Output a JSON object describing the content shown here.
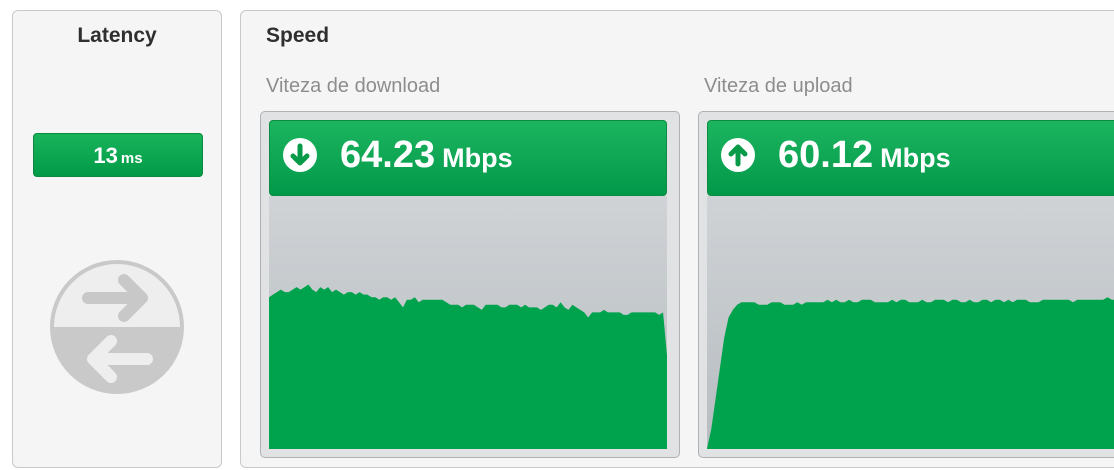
{
  "latency": {
    "title": "Latency",
    "value": "13",
    "unit": "ms",
    "icon": "exchange-arrows-icon"
  },
  "speed": {
    "title": "Speed",
    "download": {
      "label": "Viteza de download",
      "value": "64.23",
      "unit": "Mbps",
      "icon": "download-arrow-icon",
      "chart_fraction_samples": [
        0.6,
        0.61,
        0.62,
        0.63,
        0.62,
        0.62,
        0.63,
        0.64,
        0.63,
        0.64,
        0.65,
        0.63,
        0.62,
        0.64,
        0.63,
        0.64,
        0.62,
        0.63,
        0.62,
        0.61,
        0.62,
        0.62,
        0.61,
        0.62,
        0.61,
        0.61,
        0.6,
        0.6,
        0.59,
        0.6,
        0.6,
        0.59,
        0.6,
        0.58,
        0.56,
        0.59,
        0.59,
        0.6,
        0.58,
        0.59,
        0.59,
        0.59,
        0.59,
        0.59,
        0.59,
        0.58,
        0.57,
        0.57,
        0.57,
        0.56,
        0.57,
        0.57,
        0.57,
        0.56,
        0.55,
        0.57,
        0.57,
        0.57,
        0.57,
        0.56,
        0.56,
        0.57,
        0.57,
        0.57,
        0.56,
        0.57,
        0.56,
        0.56,
        0.56,
        0.55,
        0.56,
        0.57,
        0.57,
        0.56,
        0.58,
        0.56,
        0.55,
        0.57,
        0.56,
        0.55,
        0.54,
        0.52,
        0.54,
        0.54,
        0.54,
        0.55,
        0.54,
        0.54,
        0.54,
        0.54,
        0.53,
        0.53,
        0.54,
        0.54,
        0.54,
        0.54,
        0.54,
        0.54,
        0.54,
        0.53,
        0.54,
        0.37
      ]
    },
    "upload": {
      "label": "Viteza de upload",
      "value": "60.12",
      "unit": "Mbps",
      "icon": "upload-arrow-icon",
      "chart_fraction_samples": [
        0.0,
        0.08,
        0.2,
        0.32,
        0.44,
        0.52,
        0.55,
        0.57,
        0.58,
        0.58,
        0.58,
        0.58,
        0.57,
        0.57,
        0.57,
        0.58,
        0.58,
        0.58,
        0.57,
        0.57,
        0.57,
        0.58,
        0.57,
        0.58,
        0.58,
        0.58,
        0.58,
        0.58,
        0.59,
        0.58,
        0.59,
        0.58,
        0.58,
        0.59,
        0.58,
        0.58,
        0.59,
        0.59,
        0.59,
        0.58,
        0.58,
        0.58,
        0.58,
        0.59,
        0.58,
        0.59,
        0.59,
        0.58,
        0.58,
        0.58,
        0.59,
        0.58,
        0.58,
        0.59,
        0.59,
        0.59,
        0.58,
        0.59,
        0.59,
        0.58,
        0.58,
        0.59,
        0.58,
        0.58,
        0.59,
        0.59,
        0.58,
        0.59,
        0.59,
        0.58,
        0.59,
        0.58,
        0.59,
        0.59,
        0.59,
        0.58,
        0.58,
        0.58,
        0.59,
        0.59,
        0.59,
        0.59,
        0.59,
        0.59,
        0.59,
        0.58,
        0.59,
        0.59,
        0.59,
        0.59,
        0.59,
        0.59,
        0.59,
        0.6,
        0.59,
        0.59,
        0.59,
        0.6,
        0.62
      ]
    }
  },
  "colors": {
    "green": "#00a34d",
    "dark_green": "#0b8a3f",
    "chart_bg": "#c4c8cb",
    "icon_gray": "#c8c8c8"
  }
}
